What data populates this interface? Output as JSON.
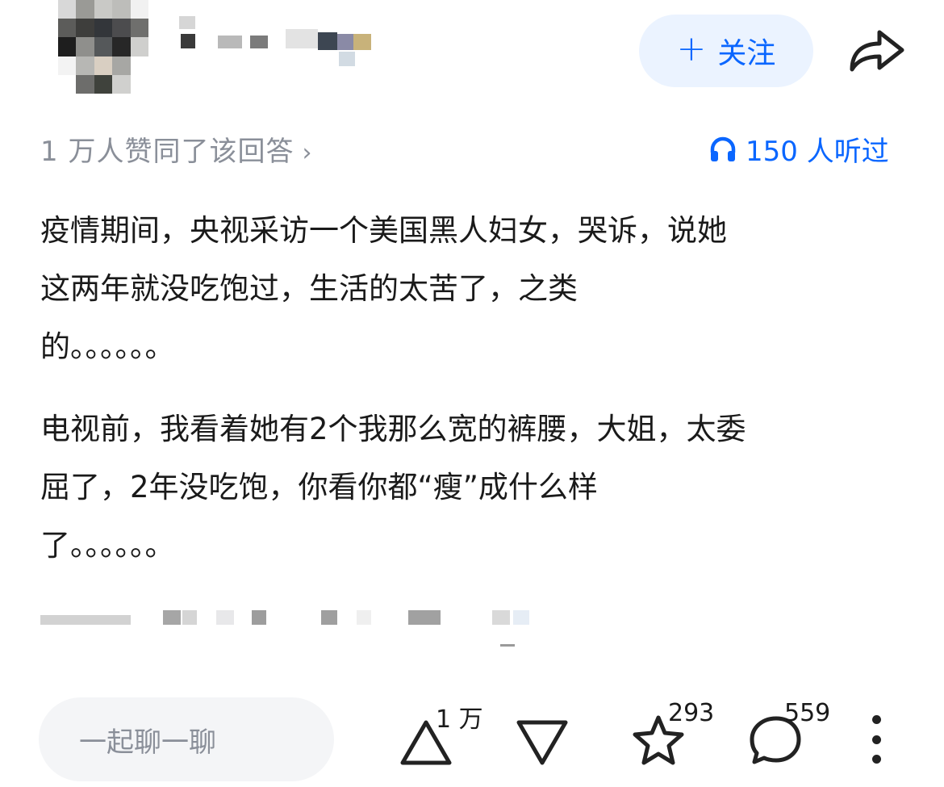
{
  "author": {
    "avatar_icon": "blurred-avatar",
    "name_blurred": true
  },
  "actions": {
    "follow_label": "关注",
    "share_icon": "share-arrow-icon"
  },
  "answer_meta": {
    "agree_text": "1 万人赞同了该回答",
    "agree_chevron": "›",
    "listen_text": "150 人听过"
  },
  "content": {
    "para1": [
      "疫情期间，央视采访一个美国黑人妇女，哭诉，说她",
      "这两年就没吃饱过，生活的太苦了，之类",
      "的。。。。。。"
    ],
    "para2": [
      "电视前，我看着她有2个我那么宽的裤腰，大姐，太委",
      "屈了，2年没吃饱，你看你都“瘦”成什么样",
      "了。。。。。。"
    ]
  },
  "bottom_bar": {
    "chat_placeholder": "一起聊一聊",
    "upvote_count": "1 万",
    "favorite_count": "293",
    "comment_count": "559"
  },
  "colors": {
    "accent": "#0a66ff",
    "follow_bg": "#ebf3ff",
    "muted_text": "#8a8f99",
    "input_bg": "#f4f5f7"
  }
}
